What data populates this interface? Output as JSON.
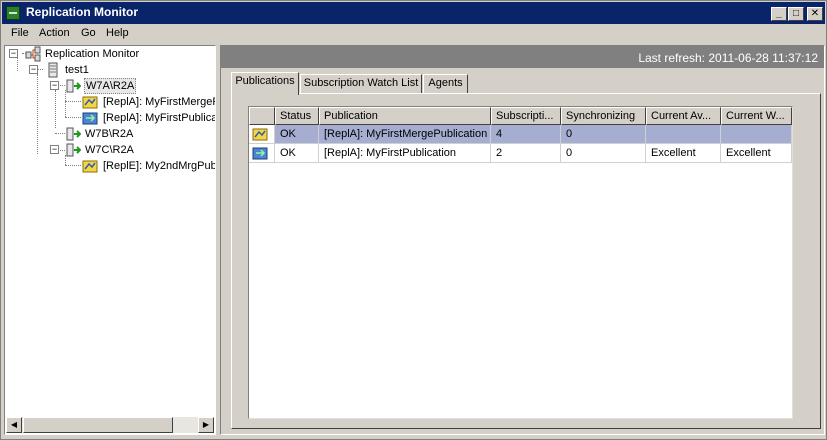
{
  "window": {
    "title": "Replication Monitor",
    "icon": "replication-monitor-app-icon",
    "buttons": {
      "minimize": "_",
      "maximize": "□",
      "close": "✕"
    }
  },
  "menu": {
    "items": [
      "File",
      "Action",
      "Go",
      "Help"
    ]
  },
  "tree": {
    "root": {
      "label": "Replication Monitor",
      "icon": "replication-monitor-icon"
    },
    "nodes": [
      {
        "label": "test1",
        "icon": "distributor-server-icon"
      },
      {
        "label": "W7A\\R2A",
        "icon": "publisher-icon"
      },
      {
        "label": "[ReplA]: MyFirstMergeP",
        "icon": "merge-publication-icon"
      },
      {
        "label": "[ReplA]: MyFirstPublicat",
        "icon": "transactional-publication-icon"
      },
      {
        "label": "W7B\\R2A",
        "icon": "publisher-icon"
      },
      {
        "label": "W7C\\R2A",
        "icon": "publisher-icon"
      },
      {
        "label": "[ReplE]: My2ndMrgPub",
        "icon": "merge-publication-icon"
      }
    ]
  },
  "status": {
    "last_refresh": "Last refresh: 2011-06-28 11:37:12"
  },
  "tabs": [
    {
      "label": "Publications"
    },
    {
      "label": "Subscription Watch List"
    },
    {
      "label": "Agents"
    }
  ],
  "grid": {
    "columns": [
      "",
      "Status",
      "Publication",
      "Subscripti...",
      "Synchronizing",
      "Current Av...",
      "Current W..."
    ],
    "rows": [
      {
        "icon": "merge-publication-icon",
        "status": "OK",
        "publication": "[ReplA]: MyFirstMergePublication",
        "subscriptions": "4",
        "synchronizing": "0",
        "current_avg": "",
        "current_worst": ""
      },
      {
        "icon": "transactional-publication-icon",
        "status": "OK",
        "publication": "[ReplA]: MyFirstPublication",
        "subscriptions": "2",
        "synchronizing": "0",
        "current_avg": "Excellent",
        "current_worst": "Excellent"
      }
    ]
  },
  "colors": {
    "titlebar": "#0a246a",
    "selection": "#a5aed0",
    "chrome": "#d4d0c8"
  }
}
